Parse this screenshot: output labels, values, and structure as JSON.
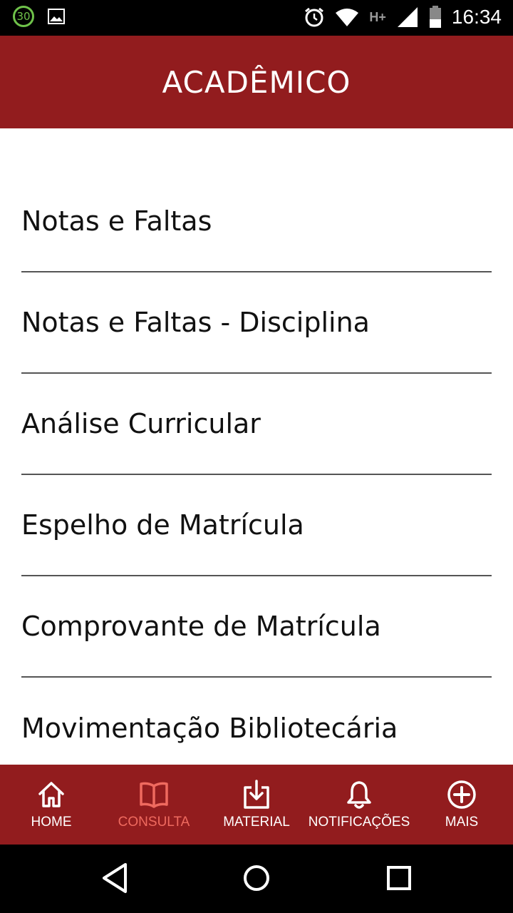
{
  "status_bar": {
    "badge": "30",
    "network": "H+",
    "time": "16:34"
  },
  "app_bar": {
    "title": "ACADÊMICO"
  },
  "menu": {
    "items": [
      {
        "label": "Notas e Faltas"
      },
      {
        "label": "Notas e Faltas - Disciplina"
      },
      {
        "label": "Análise Curricular"
      },
      {
        "label": "Espelho de Matrícula"
      },
      {
        "label": "Comprovante de Matrícula"
      },
      {
        "label": "Movimentação Bibliotecária"
      }
    ]
  },
  "bottom_nav": {
    "items": [
      {
        "label": "HOME",
        "icon": "home-icon",
        "active": false
      },
      {
        "label": "CONSULTA",
        "icon": "book-icon",
        "active": true
      },
      {
        "label": "MATERIAL",
        "icon": "download-icon",
        "active": false
      },
      {
        "label": "NOTIFICAÇÕES",
        "icon": "bell-icon",
        "active": false
      },
      {
        "label": "MAIS",
        "icon": "plus-circle-icon",
        "active": false
      }
    ]
  },
  "colors": {
    "brand": "#921c1e",
    "active": "#ef6a5f"
  }
}
